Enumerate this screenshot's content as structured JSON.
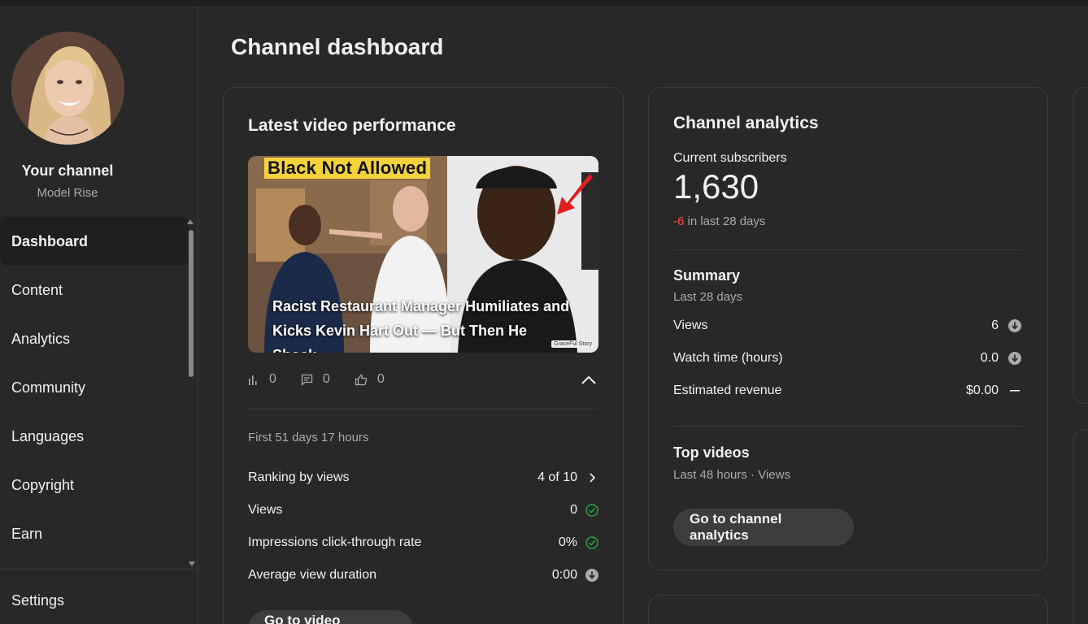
{
  "sidebar": {
    "channel_title": "Your channel",
    "channel_name": "Model Rise",
    "items": [
      {
        "label": "Dashboard",
        "active": true
      },
      {
        "label": "Content"
      },
      {
        "label": "Analytics"
      },
      {
        "label": "Community"
      },
      {
        "label": "Languages"
      },
      {
        "label": "Copyright"
      },
      {
        "label": "Earn"
      }
    ],
    "settings_label": "Settings"
  },
  "page": {
    "title": "Channel dashboard"
  },
  "latest_video": {
    "heading": "Latest video performance",
    "thumbnail_banner": "Black Not Allowed",
    "thumbnail_watermark": "GraceFul Story",
    "video_title": "Racist Restaurant Manager Humiliates and Kicks Kevin Hart Out — But Then He Shock…",
    "views_count": "0",
    "comments_count": "0",
    "likes_count": "0",
    "period": "First 51 days 17 hours",
    "metrics": [
      {
        "label": "Ranking by views",
        "value": "4 of 10",
        "icon": "chevron-right-icon"
      },
      {
        "label": "Views",
        "value": "0",
        "icon": "check-circle-icon"
      },
      {
        "label": "Impressions click-through rate",
        "value": "0%",
        "icon": "check-circle-icon"
      },
      {
        "label": "Average view duration",
        "value": "0:00",
        "icon": "arrow-down-circle-icon"
      }
    ],
    "button_label": "Go to video analytics"
  },
  "channel_analytics": {
    "heading": "Channel analytics",
    "subscribers_label": "Current subscribers",
    "subscribers_value": "1,630",
    "change_value": "-6",
    "change_suffix": " in last 28 days",
    "summary_heading": "Summary",
    "summary_period": "Last 28 days",
    "summary_rows": [
      {
        "label": "Views",
        "value": "6",
        "icon": "arrow-down-circle-icon"
      },
      {
        "label": "Watch time (hours)",
        "value": "0.0",
        "icon": "arrow-down-circle-icon"
      },
      {
        "label": "Estimated revenue",
        "value": "$0.00",
        "icon": "dash-icon"
      }
    ],
    "top_videos_heading": "Top videos",
    "top_videos_sub": "Last 48 hours · Views",
    "button_label": "Go to channel analytics"
  },
  "colors": {
    "background": "#282828",
    "negative": "#ff4e45",
    "success": "#2ba640",
    "muted": "#aaaaaa"
  }
}
